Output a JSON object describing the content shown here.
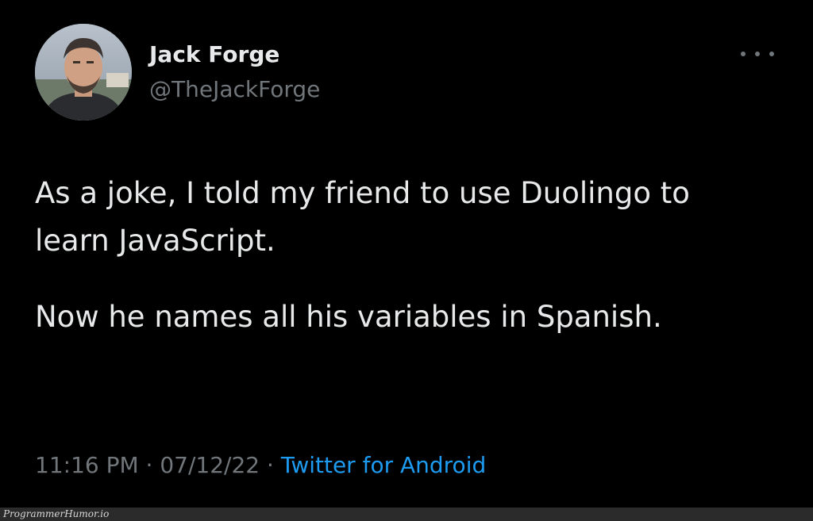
{
  "tweet": {
    "author": {
      "display_name": "Jack Forge",
      "handle": "@TheJackForge"
    },
    "paragraphs": [
      "As a joke, I told my friend to use Duolingo to learn JavaScript.",
      "Now he names all his variables in Spanish."
    ],
    "time": "11:16 PM",
    "date": "07/12/22",
    "separator": "·",
    "source": "Twitter for Android",
    "more_icon": "more-horizontal-icon"
  },
  "watermark": "ProgrammerHumor.io",
  "colors": {
    "background": "#000000",
    "text": "#e7e9ea",
    "secondary": "#71767b",
    "link": "#1d9bf0"
  }
}
